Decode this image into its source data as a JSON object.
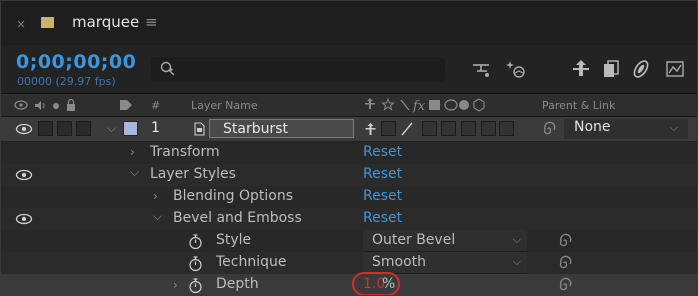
{
  "composition": {
    "tab_close": "×",
    "name": "marquee",
    "menu": "≡"
  },
  "time": {
    "timecode": "0;00;00;00",
    "frames": "00000 (29.97 fps)"
  },
  "search": {
    "placeholder": ""
  },
  "header": {
    "layer_name": "Layer Name",
    "parent_link": "Parent & Link",
    "hash": "#"
  },
  "layer": {
    "number": "1",
    "name": "Starburst",
    "parent": "None"
  },
  "rows": {
    "transform": "Transform",
    "layer_styles": "Layer Styles",
    "blending": "Blending Options",
    "bevel": "Bevel and Emboss",
    "style": "Style",
    "technique": "Technique",
    "depth": "Depth"
  },
  "values": {
    "reset": "Reset",
    "style": "Outer Bevel",
    "technique": "Smooth",
    "depth_value": "1.0",
    "depth_unit": "%"
  },
  "colors": {
    "accent": "#3f95d9",
    "highlight_ring": "#d22d2d",
    "label_swatch": "#c8b46e"
  }
}
